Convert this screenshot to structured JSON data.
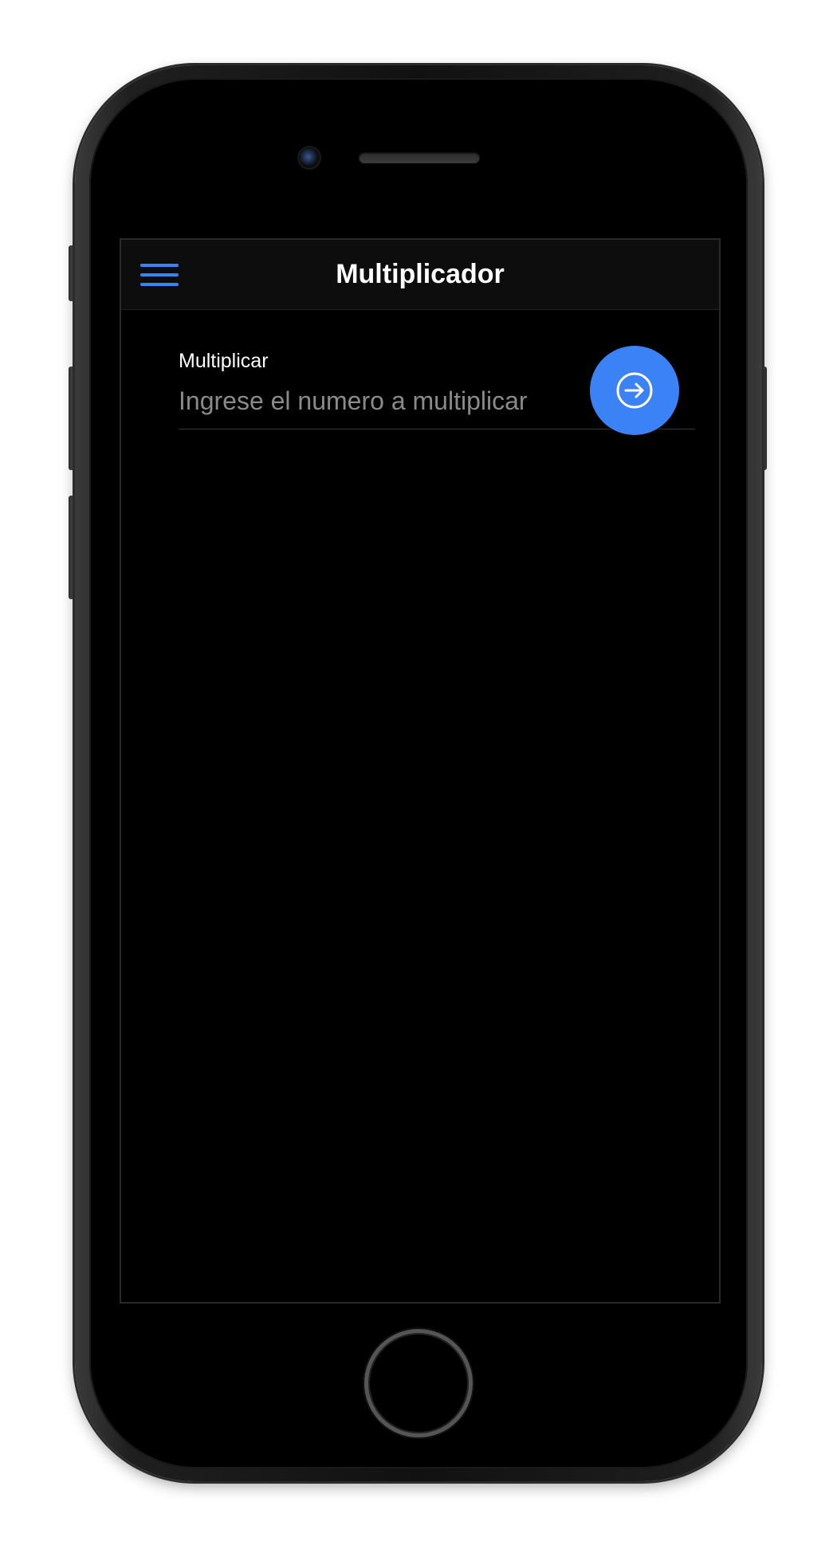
{
  "header": {
    "title": "Multiplicador",
    "menu_icon": "hamburger-menu-icon"
  },
  "form": {
    "label": "Multiplicar",
    "value": "",
    "placeholder": "Ingrese el numero a multiplicar",
    "submit_icon": "arrow-forward-circle-icon"
  },
  "colors": {
    "accent": "#3b82f6",
    "background": "#000000",
    "toolbar": "#0d0d0d",
    "text": "#ffffff",
    "placeholder": "#8a8a8a"
  }
}
